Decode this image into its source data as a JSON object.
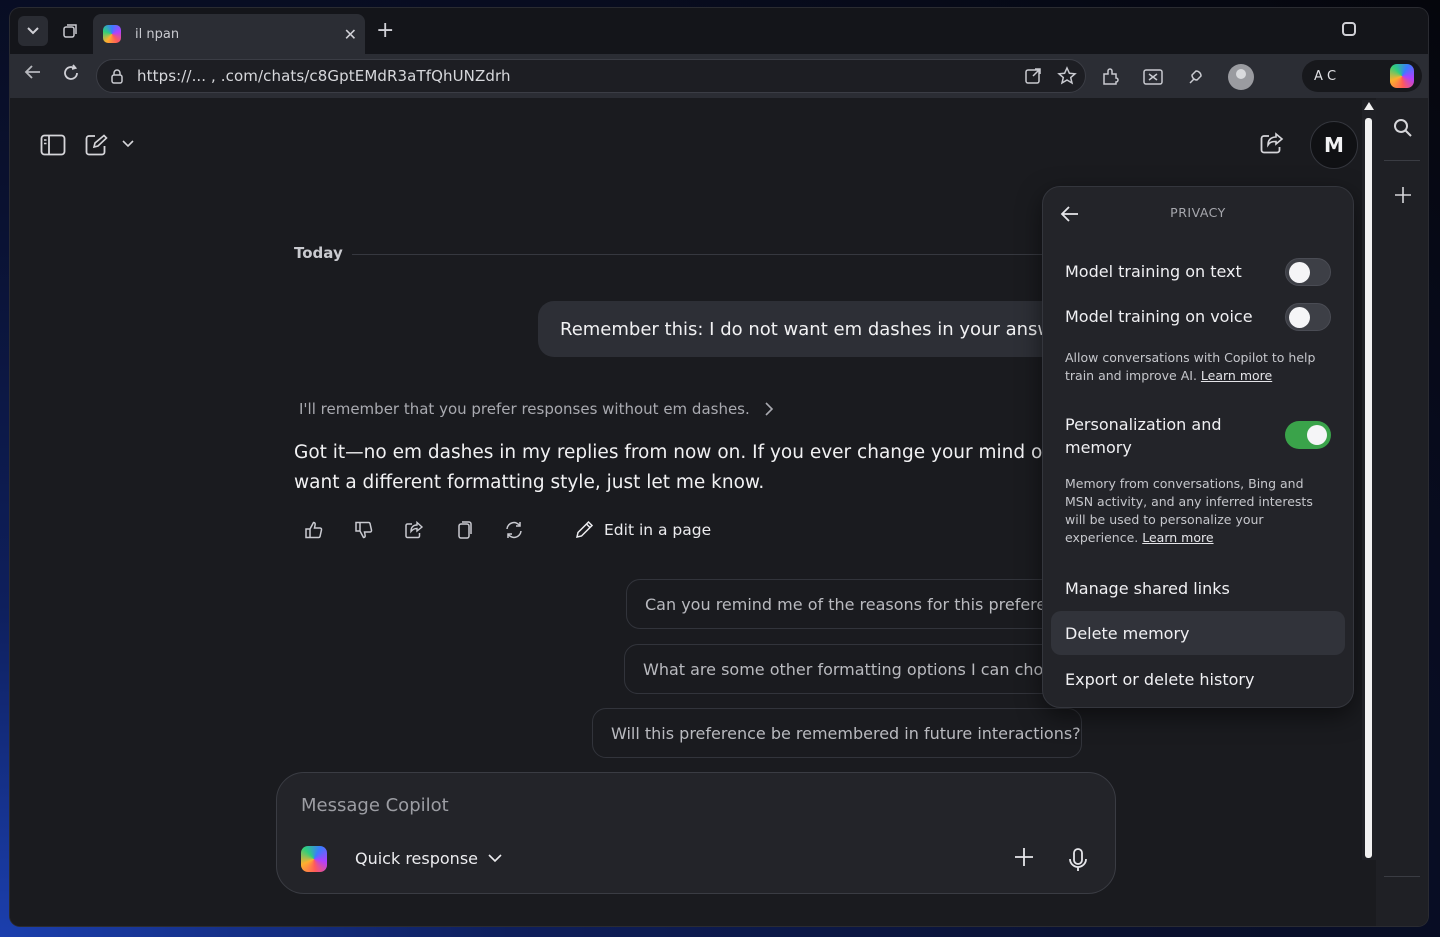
{
  "browser": {
    "tab_title": "il                  npan",
    "tab_close": "✕",
    "new_tab": "+",
    "url": "https://...  ,                  .com/chats/c8GptEMdR3aTfQhUNZdrh",
    "profile_name": "A  C"
  },
  "header": {
    "avatar_initial": "M"
  },
  "chat": {
    "date_divider": "Today",
    "user_message": "Remember this: I do not want em dashes in your answers",
    "memory_note": "I'll remember that you prefer responses without em dashes.",
    "assistant_reply": "Got it—no em dashes in my replies from now on. If you ever change your mind or want a different formatting style, just let me know.",
    "edit_in_page": "Edit in a page",
    "suggestions": [
      "Can you remind me of the reasons for this preference?",
      "What are some other formatting options I can choose?",
      "Will this preference be remembered in future interactions?"
    ]
  },
  "composer": {
    "placeholder": "Message Copilot",
    "mode": "Quick response"
  },
  "privacy_panel": {
    "title": "PRIVACY",
    "model_training_text": {
      "label": "Model training on text",
      "enabled": false
    },
    "model_training_voice": {
      "label": "Model training on voice",
      "enabled": false
    },
    "training_desc": "Allow conversations with Copilot to help train and improve AI.",
    "learn_more": "Learn more",
    "personalization": {
      "label_line1": "Personalization and",
      "label_line2": "memory",
      "enabled": true
    },
    "memory_desc": "Memory from conversations, Bing and MSN activity, and any inferred interests will be used to personalize your experience.",
    "learn_more_2": "Learn more",
    "items": [
      "Manage shared links",
      "Delete memory",
      "Export or delete history"
    ]
  },
  "colors": {
    "accent_green": "#3aa34a",
    "background": "#1a1b1f",
    "panel": "#232429"
  }
}
